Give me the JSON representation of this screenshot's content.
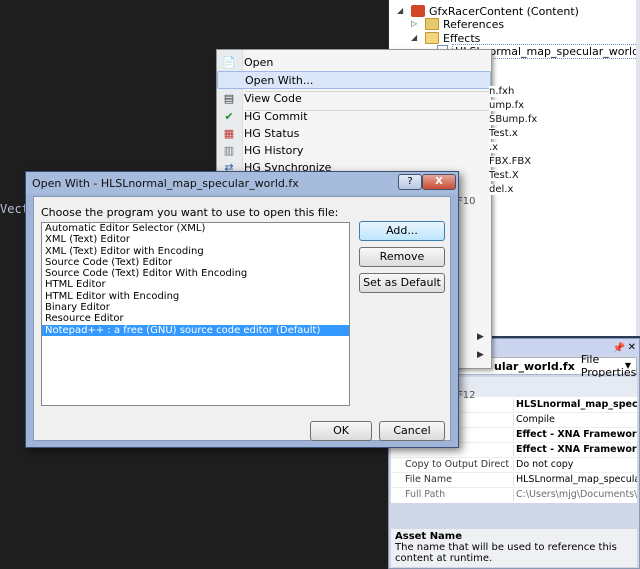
{
  "editor": {
    "text": "Vect"
  },
  "solution": {
    "project": "GfxRacerContent (Content)",
    "references": "References",
    "effects": "Effects",
    "selected_file": "HLSLnormal_map_specular_world.fx",
    "partial_files": [
      "n.fxh",
      "ump.fx",
      "SBump.fx",
      "Test.x",
      ".x",
      "FBX.FBX",
      "Test.X",
      "del.x"
    ]
  },
  "context_menu": {
    "items": [
      {
        "label": "Open",
        "icon": "open-icon"
      },
      {
        "label": "Open With...",
        "icon": ""
      },
      {
        "label": "View Code",
        "icon": "view-code-icon"
      },
      {
        "label": "HG Commit",
        "icon": "hg-commit-icon"
      },
      {
        "label": "HG Status",
        "icon": "hg-status-icon"
      },
      {
        "label": "HG History",
        "icon": "hg-history-icon"
      },
      {
        "label": "HG Synchronize",
        "icon": "hg-sync-icon"
      }
    ],
    "shortcut_f10": "F10",
    "shortcut_f12": "F12"
  },
  "dialog": {
    "title": "Open With - HLSLnormal_map_specular_world.fx",
    "help_label": "?",
    "close_label": "X",
    "prompt": "Choose the program you want to use to open this file:",
    "programs": [
      "Automatic Editor Selector (XML)",
      "XML (Text) Editor",
      "XML (Text) Editor with Encoding",
      "Source Code (Text) Editor",
      "Source Code (Text) Editor With Encoding",
      "HTML Editor",
      "HTML Editor with Encoding",
      "Binary Editor",
      "Resource Editor",
      "Notepad++ : a free (GNU) source code editor (Default)"
    ],
    "selected_index": 9,
    "buttons": {
      "add": "Add...",
      "remove": "Remove",
      "set_default": "Set as Default",
      "ok": "OK",
      "cancel": "Cancel"
    }
  },
  "properties": {
    "title": "Properties",
    "selected_name": "ular_world.fx",
    "selected_type": "File Properties",
    "rows": [
      {
        "name": "",
        "value": "HLSLnormal_map_specular_wor",
        "bold": true,
        "gray": false
      },
      {
        "name": "",
        "value": "Compile",
        "bold": false,
        "gray": false
      },
      {
        "name": "",
        "value": "Effect - XNA Framework",
        "bold": true,
        "gray": false
      },
      {
        "name": "",
        "value": "Effect - XNA Framework",
        "bold": true,
        "gray": false
      },
      {
        "name": "Copy to Output Directory",
        "value": "Do not copy",
        "bold": false,
        "gray": false
      },
      {
        "name": "File Name",
        "value": "HLSLnormal_map_specular_wor",
        "bold": false,
        "gray": false
      },
      {
        "name": "Full Path",
        "value": "C:\\Users\\mjg\\Documents\\Visu",
        "bold": false,
        "gray": true
      }
    ],
    "desc_title": "Asset Name",
    "desc_text": "The name that will be used to reference this content at runtime."
  },
  "colors": {
    "selection": "#3399ff",
    "editor_bg": "#1e1e1e",
    "menu_highlight": "#dbe7f8"
  }
}
